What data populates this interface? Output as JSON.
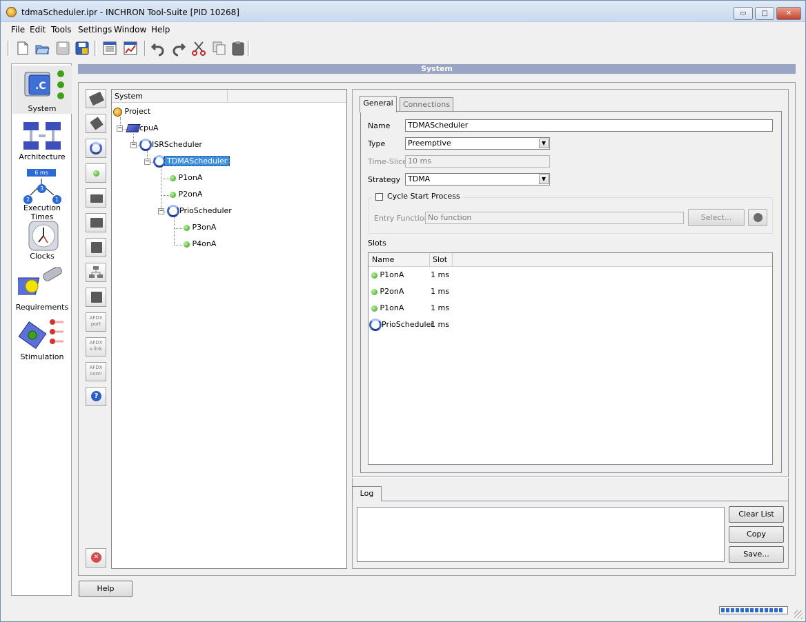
{
  "window": {
    "title": "tdmaScheduler.ipr - INCHRON Tool-Suite [PID 10268]",
    "minimize_glyph": "▭",
    "maximize_glyph": "□",
    "close_glyph": "✕"
  },
  "menu": [
    "File",
    "Edit",
    "Tools",
    "Settings",
    "Window",
    "Help"
  ],
  "toolbar_icons": [
    "new-file-icon",
    "open-folder-icon",
    "save-icon",
    "save-as-icon",
    "properties-icon",
    "chart-icon",
    "undo-icon",
    "redo-icon",
    "cut-icon",
    "copy-icon",
    "paste-icon"
  ],
  "nav": {
    "items": [
      {
        "label": "System",
        "icon": "system-c-icon"
      },
      {
        "label": "Architecture",
        "icon": "architecture-icon"
      },
      {
        "label": "Execution Times",
        "icon": "execution-times-icon",
        "badge": "6 ms",
        "nodes": [
          "2",
          "3",
          "1"
        ]
      },
      {
        "label": "Clocks",
        "icon": "clock-icon"
      },
      {
        "label": "Requirements",
        "icon": "requirements-icon"
      },
      {
        "label": "Stimulation",
        "icon": "stimulation-icon"
      }
    ]
  },
  "header": {
    "title": "System"
  },
  "vtoolbar": {
    "afdx_port": [
      "AFDX",
      "port"
    ],
    "afdx_vlink": [
      "AFDX",
      "v.link"
    ],
    "afdx_conn": [
      "AFDX",
      "conn"
    ],
    "help_glyph": "?",
    "delete_glyph": "✕"
  },
  "tree": {
    "column": "System",
    "nodes": {
      "project": "Project",
      "cpu": "cpuA",
      "isr": "ISRScheduler",
      "tdma": "TDMAScheduler",
      "p1": "P1onA",
      "p2": "P2onA",
      "prio": "PrioScheduler",
      "p3": "P3onA",
      "p4": "P4onA"
    }
  },
  "tabs": {
    "general": "General",
    "connections": "Connections"
  },
  "form": {
    "name_label": "Name",
    "name_value": "TDMAScheduler",
    "type_label": "Type",
    "type_value": "Preemptive",
    "timeslice_label": "Time-Slice",
    "timeslice_value": "10 ms",
    "strategy_label": "Strategy",
    "strategy_value": "TDMA",
    "cycle_label": "Cycle Start Process",
    "entry_label": "Entry Function",
    "entry_value": "No function",
    "select_button": "Select...",
    "slots_label": "Slots",
    "dropdown_glyph": "▼",
    "checkbox_checked": false
  },
  "slots": {
    "columns": [
      "Name",
      "Slot"
    ],
    "rows": [
      {
        "name": "P1onA",
        "slot": "1 ms"
      },
      {
        "name": "P2onA",
        "slot": "1 ms"
      },
      {
        "name": "P1onA",
        "slot": "1 ms"
      },
      {
        "name": "PrioScheduler",
        "slot": "1 ms"
      }
    ]
  },
  "log": {
    "tab": "Log",
    "clear": "Clear List",
    "copy": "Copy",
    "save": "Save..."
  },
  "help_button": "Help",
  "colors": {
    "selection": "#3a8fe8",
    "header": "#9aa4c4",
    "green": "#2f9a0e",
    "blue": "#3c63c9"
  }
}
